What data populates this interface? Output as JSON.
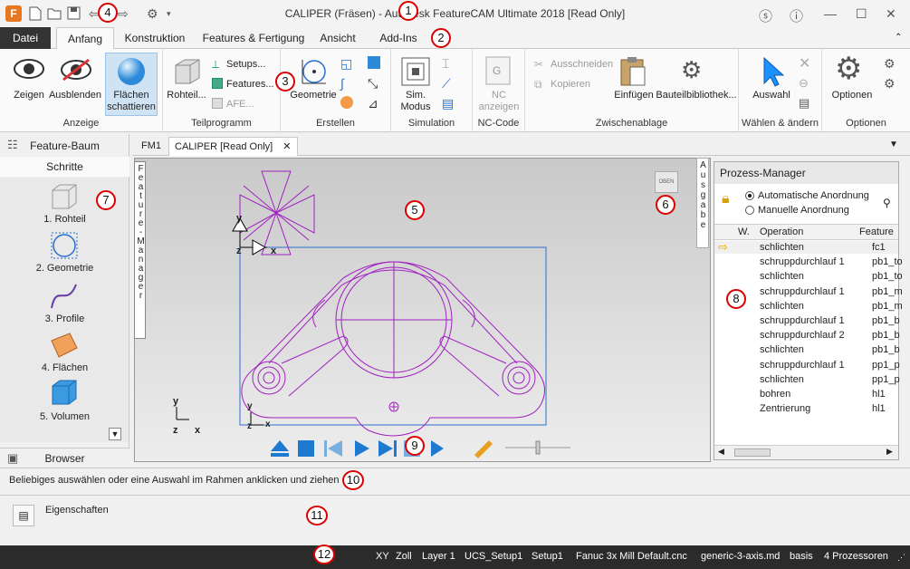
{
  "window": {
    "title": "CALIPER (Fräsen) - Autodesk FeatureCAM Ultimate 2018 [Read Only]"
  },
  "ribbon_tabs": [
    "Datei",
    "Anfang",
    "Konstruktion",
    "Features & Fertigung",
    "Ansicht",
    "Add-Ins"
  ],
  "ribbon": {
    "anzeige": {
      "label": "Anzeige",
      "zeigen": "Zeigen",
      "ausblenden": "Ausblenden",
      "schattieren_1": "Flächen",
      "schattieren_2": "schattieren"
    },
    "teilprogramm": {
      "label": "Teilprogramm",
      "rohteil": "Rohteil...",
      "setups": "Setups...",
      "features": "Features...",
      "afe": "AFE..."
    },
    "erstellen": {
      "label": "Erstellen",
      "geometrie": "Geometrie"
    },
    "simulation": {
      "label": "Simulation",
      "sim_1": "Sim.",
      "sim_2": "Modus"
    },
    "nccode": {
      "label": "NC-Code",
      "nc_1": "NC",
      "nc_2": "anzeigen"
    },
    "zwischenablage": {
      "label": "Zwischenablage",
      "ausschneiden": "Ausschneiden",
      "kopieren": "Kopieren",
      "einfuegen": "Einfügen",
      "bauteil": "Bauteilbibliothek..."
    },
    "waehlen": {
      "label": "Wählen & ändern",
      "auswahl": "Auswahl"
    },
    "optionen": {
      "label": "Optionen",
      "optionen": "Optionen"
    }
  },
  "left_panel": {
    "feature_baum": "Feature-Baum",
    "schritte": "Schritte",
    "steps": [
      "1.  Rohteil",
      "2.  Geometrie",
      "3.  Profile",
      "4.  Flächen",
      "5.  Volumen"
    ],
    "browser": "Browser"
  },
  "vertical_tab": "Feature-Manager",
  "doc_tabs": [
    "FM1",
    "CALIPER [Read Only]"
  ],
  "viewport": {
    "axis_x": "x",
    "axis_y": "y",
    "axis_z": "z",
    "view_badge": "OBEN"
  },
  "ausgabe_tab": "Ausgabe",
  "process_manager": {
    "title": "Prozess-Manager",
    "opt_auto": "Automatische Anordnung",
    "opt_manual": "Manuelle Anordnung",
    "col_w": "W.",
    "col_op": "Operation",
    "col_feature": "Feature",
    "rows": [
      {
        "op": "schlichten",
        "feature": "fc1"
      },
      {
        "op": "schruppdurchlauf 1",
        "feature": "pb1_to"
      },
      {
        "op": "schlichten",
        "feature": "pb1_to"
      },
      {
        "op": "schruppdurchlauf 1",
        "feature": "pb1_m"
      },
      {
        "op": "schlichten",
        "feature": "pb1_m"
      },
      {
        "op": "schruppdurchlauf 1",
        "feature": "pb1_b"
      },
      {
        "op": "schruppdurchlauf 2",
        "feature": "pb1_b"
      },
      {
        "op": "schlichten",
        "feature": "pb1_b"
      },
      {
        "op": "schruppdurchlauf 1",
        "feature": "pp1_p"
      },
      {
        "op": "schlichten",
        "feature": "pp1_p"
      },
      {
        "op": "bohren",
        "feature": "hl1"
      },
      {
        "op": "Zentrierung",
        "feature": "hl1"
      }
    ]
  },
  "hint_text": "Beliebiges auswählen oder eine Auswahl im Rahmen anklicken und ziehen",
  "properties_label": "Eigenschaften",
  "status_bar": [
    "XY",
    "Zoll",
    "Layer 1",
    "UCS_Setup1",
    "Setup1",
    "Fanuc 3x Mill Default.cnc",
    "generic-3-axis.md",
    "basis",
    "4 Prozessoren"
  ],
  "callouts": [
    "1",
    "2",
    "3",
    "4",
    "5",
    "6",
    "7",
    "8",
    "9",
    "10",
    "11",
    "12"
  ],
  "colors": {
    "geometry": "#a020c0",
    "stock_box": "#2a6fd0",
    "accent": "#1e90ff",
    "status_bg": "#2b2b2b"
  }
}
